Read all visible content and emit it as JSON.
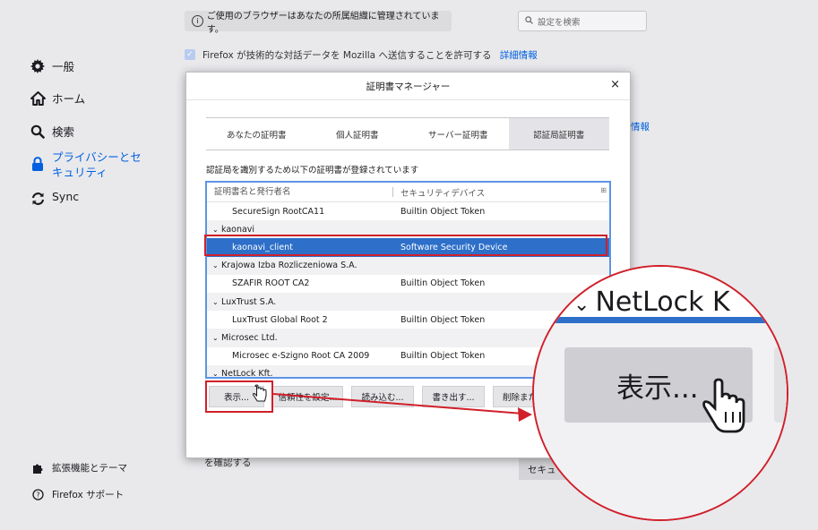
{
  "sidebar": {
    "items": [
      {
        "label": "一般",
        "icon": "gear-icon"
      },
      {
        "label": "ホーム",
        "icon": "home-icon"
      },
      {
        "label": "検索",
        "icon": "search-icon"
      },
      {
        "label": "プライバシーとセキュリティ",
        "icon": "lock-icon"
      },
      {
        "label": "Sync",
        "icon": "sync-icon"
      }
    ],
    "footer": [
      {
        "label": "拡張機能とテーマ",
        "icon": "puzzle-icon"
      },
      {
        "label": "Firefox サポート",
        "icon": "help-icon"
      }
    ]
  },
  "background": {
    "managed_notice": "ご使用のブラウザーはあなたの所属組織に管理されています。",
    "search_placeholder": "設定を検索",
    "telemetry_text": "Firefox が技術的な対話データを Mozilla へ送信することを許可する",
    "telemetry_link": "詳細情報",
    "right_link": "情報",
    "bottom_text": "を確認する",
    "bottom_button": "セキュ"
  },
  "dialog": {
    "title": "証明書マネージャー",
    "close": "×",
    "tabs": [
      "あなたの証明書",
      "個人証明書",
      "サーバー証明書",
      "認証局証明書"
    ],
    "selected_tab": "認証局証明書",
    "description": "認証局を識別するため以下の証明書が登録されています",
    "columns": [
      "証明書名と発行者名",
      "セキュリティデバイス"
    ],
    "rows": [
      {
        "type": "cert",
        "name": "SecureSign RootCA11",
        "device": "Builtin Object Token"
      },
      {
        "type": "group",
        "name": "kaonavi"
      },
      {
        "type": "cert",
        "name": "kaonavi_client",
        "device": "Software Security Device",
        "selected": true
      },
      {
        "type": "group",
        "name": "Krajowa Izba Rozliczeniowa S.A."
      },
      {
        "type": "cert",
        "name": "SZAFIR ROOT CA2",
        "device": "Builtin Object Token"
      },
      {
        "type": "group",
        "name": "LuxTrust S.A."
      },
      {
        "type": "cert",
        "name": "LuxTrust Global Root 2",
        "device": "Builtin Object Token"
      },
      {
        "type": "group",
        "name": "Microsec Ltd."
      },
      {
        "type": "cert",
        "name": "Microsec e-Szigno Root CA 2009",
        "device": "Builtin Object Token"
      },
      {
        "type": "group",
        "name": "NetLock Kft."
      }
    ],
    "buttons": [
      "表示...",
      "信頼性を設定...",
      "読み込む...",
      "書き出す...",
      "削除また"
    ]
  },
  "zoom": {
    "group_label": "NetLock K",
    "button_label": "表示..."
  },
  "colors": {
    "accent": "#0060df",
    "selection": "#2d6fc9",
    "annotation": "#d0202a"
  }
}
